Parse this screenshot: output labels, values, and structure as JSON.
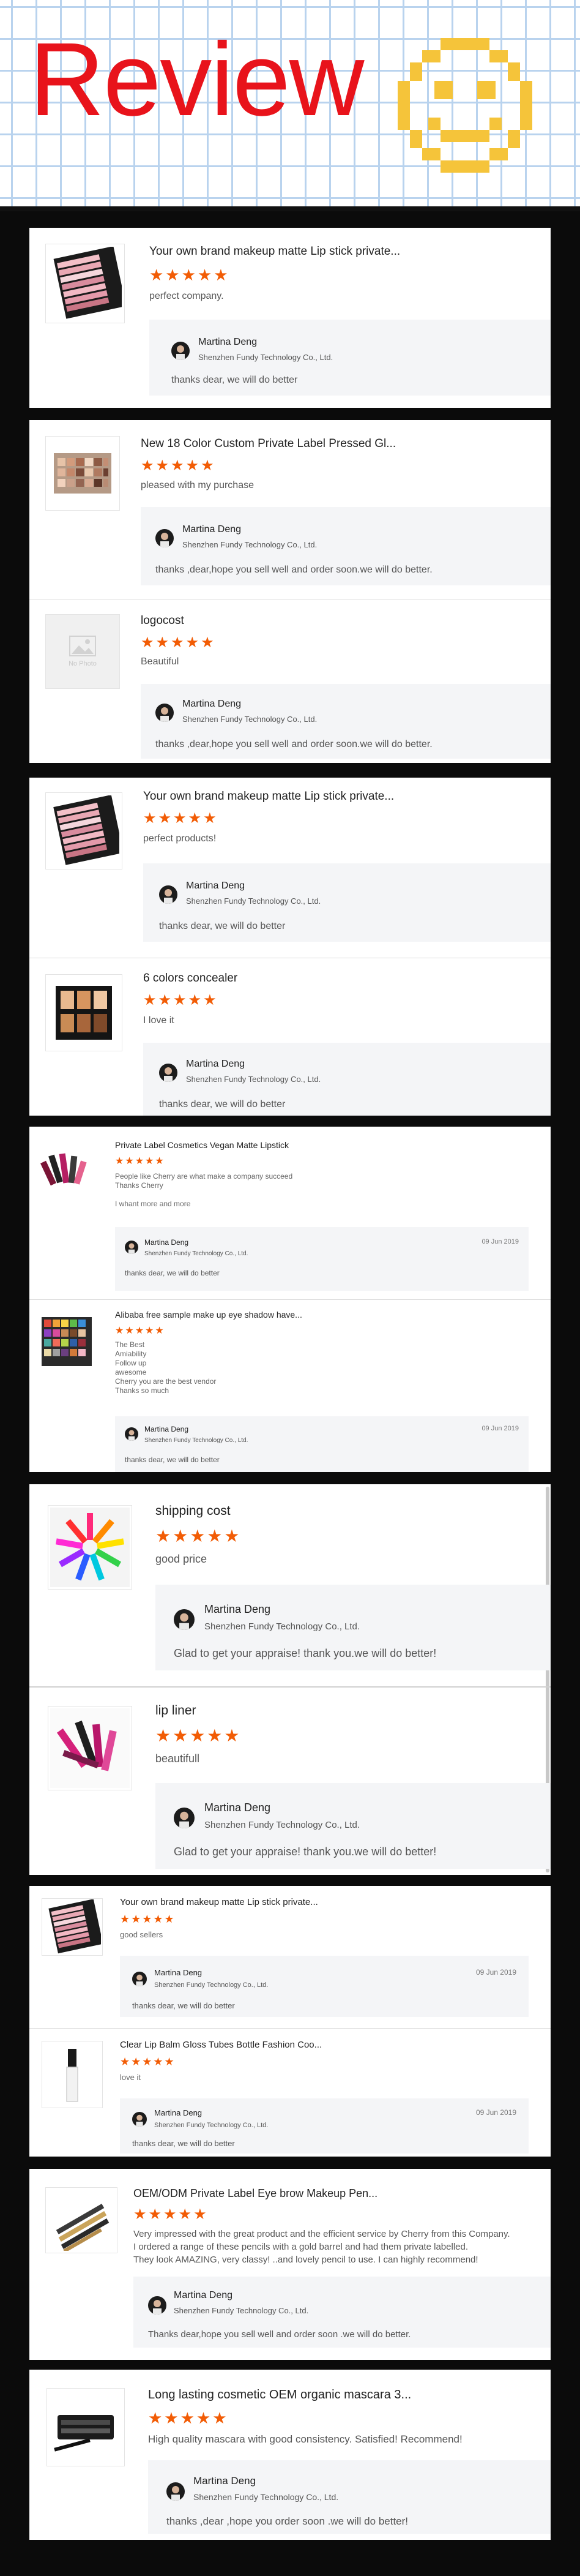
{
  "banner": {
    "title": "Review",
    "smiley_icon": "smiley-face-icon"
  },
  "reply_company": "Shenzhen Fundy Technology Co., Ltd.",
  "reply_name": "Martina Deng",
  "colors": {
    "star": "#f25c05",
    "banner_text": "#e8131b",
    "reply_bg": "#f4f5f7",
    "grid": "#b9d3ee"
  },
  "card1": {
    "r1": {
      "product": "Your own brand makeup matte Lip stick private...",
      "stars": "★★★★★",
      "text": "perfect company.",
      "reply": "thanks dear, we will do better"
    }
  },
  "card2": {
    "r1": {
      "product": "New 18 Color Custom Private Label Pressed Gl...",
      "stars": "★★★★★",
      "text": "pleased with my purchase",
      "reply": "thanks ,dear,hope you sell well and order soon.we will do better."
    },
    "r2": {
      "product": "logocost",
      "stars": "★★★★★",
      "text": "Beautiful",
      "reply": "thanks ,dear,hope you sell well and order soon.we will do better.",
      "no_photo": "No Photo"
    }
  },
  "card3": {
    "r1": {
      "product": "Your own brand makeup matte Lip stick private...",
      "stars": "★★★★★",
      "text": "perfect products!",
      "reply": "thanks dear, we will do better"
    },
    "r2": {
      "product": "6 colors concealer",
      "stars": "★★★★★",
      "text": "I love it",
      "reply": "thanks dear, we will do better"
    }
  },
  "card4": {
    "r1": {
      "product": "Private Label Cosmetics Vegan Matte Lipstick",
      "stars": "★★★★★",
      "text_lines": [
        "People like Cherry are what make a company succeed",
        "Thanks Cherry",
        "",
        "I whant more and more"
      ],
      "reply": "thanks dear, we will do better",
      "date": "09 Jun 2019"
    },
    "r2": {
      "product": "Alibaba free sample make up eye shadow have...",
      "stars": "★★★★★",
      "text_lines": [
        "The Best",
        "Amiability",
        "Follow up",
        "awesome",
        "Cherry you are the best vendor",
        "Thanks so much"
      ],
      "reply": "thanks dear, we will do better",
      "date": "09 Jun 2019"
    }
  },
  "card5": {
    "r1": {
      "product": "shipping cost",
      "stars": "★★★★★",
      "text": "good price",
      "reply": "Glad to get your appraise! thank you.we will do better!"
    },
    "r2": {
      "product": "lip liner",
      "stars": "★★★★★",
      "text": "beautifull",
      "reply": "Glad to get your appraise! thank you.we will do better!"
    }
  },
  "card6": {
    "r1": {
      "product": "Your own brand makeup matte Lip stick private...",
      "stars": "★★★★★",
      "text": "good sellers",
      "reply": "thanks dear, we will do better",
      "date": "09 Jun 2019"
    },
    "r2": {
      "product": "Clear Lip Balm Gloss Tubes Bottle Fashion Coo...",
      "stars": "★★★★★",
      "text": "love it",
      "reply": "thanks dear, we will do better",
      "date": "09 Jun 2019"
    }
  },
  "card7": {
    "r1": {
      "product": "OEM/ODM Private Label Eye brow Makeup Pen...",
      "stars": "★★★★★",
      "text_lines": [
        "Very impressed with the great product and the efficient service  by Cherry from this Company.",
        "I ordered a range of these pencils with a gold barrel and had them private labelled.",
        "They look AMAZING, very classy! ..and  lovely pencil to use. I can highly recommend!"
      ],
      "reply": "Thanks dear,hope you sell well and order soon .we will do better."
    }
  },
  "card8": {
    "r1": {
      "product": "Long lasting cosmetic OEM organic mascara 3...",
      "stars": "★★★★★",
      "text": "High quality mascara with good consistency. Satisfied! Recommend!",
      "reply": "thanks ,dear ,hope you order soon .we will do better!"
    }
  }
}
